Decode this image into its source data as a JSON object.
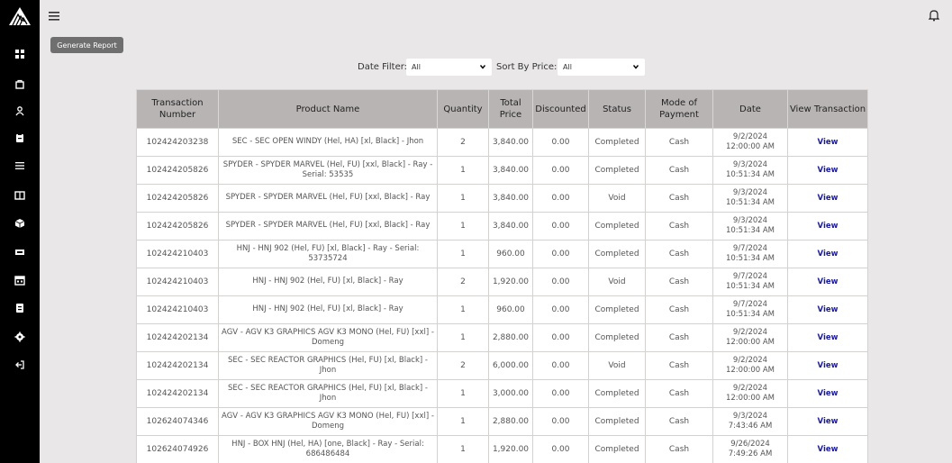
{
  "sidebar": {
    "icons": [
      "dashboard-icon",
      "bag-icon",
      "user-icon",
      "clipboard-icon",
      "list-icon",
      "book-icon",
      "cube-icon",
      "ticket-icon",
      "calendar-icon",
      "document-icon",
      "gear-icon",
      "logout-icon"
    ]
  },
  "toolbar": {
    "generate_label": "Generate Report"
  },
  "filters": {
    "date_label": "Date Filter:",
    "date_value": "All",
    "price_label": "Sort By Price:",
    "price_value": "All"
  },
  "table": {
    "headers": [
      "Transaction Number",
      "Product Name",
      "Quantity",
      "Total Price",
      "Discounted",
      "Status",
      "Mode of Payment",
      "Date",
      "View Transaction"
    ],
    "rows": [
      {
        "txn": "102424203238",
        "product": "SEC - SEC OPEN WINDY (Hel, HA) [xl, Black] - Jhon",
        "qty": "2",
        "total": "3,840.00",
        "discount": "0.00",
        "status": "Completed",
        "payment": "Cash",
        "date": "9/2/2024",
        "time": "12:00:00 AM",
        "view": "View"
      },
      {
        "txn": "102424205826",
        "product": "SPYDER - SPYDER MARVEL (Hel, FU) [xxl, Black] - Ray - Serial: 53535",
        "qty": "1",
        "total": "3,840.00",
        "discount": "0.00",
        "status": "Completed",
        "payment": "Cash",
        "date": "9/3/2024",
        "time": "10:51:34 AM",
        "view": "View"
      },
      {
        "txn": "102424205826",
        "product": "SPYDER - SPYDER MARVEL (Hel, FU) [xxl, Black] - Ray",
        "qty": "1",
        "total": "3,840.00",
        "discount": "0.00",
        "status": "Void",
        "payment": "Cash",
        "date": "9/3/2024",
        "time": "10:51:34 AM",
        "view": "View"
      },
      {
        "txn": "102424205826",
        "product": "SPYDER - SPYDER MARVEL (Hel, FU) [xxl, Black] - Ray",
        "qty": "1",
        "total": "3,840.00",
        "discount": "0.00",
        "status": "Completed",
        "payment": "Cash",
        "date": "9/3/2024",
        "time": "10:51:34 AM",
        "view": "View"
      },
      {
        "txn": "102424210403",
        "product": "HNJ - HNJ 902 (Hel, FU) [xl, Black] - Ray - Serial: 53735724",
        "qty": "1",
        "total": "960.00",
        "discount": "0.00",
        "status": "Completed",
        "payment": "Cash",
        "date": "9/7/2024",
        "time": "10:51:34 AM",
        "view": "View"
      },
      {
        "txn": "102424210403",
        "product": "HNJ - HNJ 902 (Hel, FU) [xl, Black] - Ray",
        "qty": "2",
        "total": "1,920.00",
        "discount": "0.00",
        "status": "Void",
        "payment": "Cash",
        "date": "9/7/2024",
        "time": "10:51:34 AM",
        "view": "View"
      },
      {
        "txn": "102424210403",
        "product": "HNJ - HNJ 902 (Hel, FU) [xl, Black] - Ray",
        "qty": "1",
        "total": "960.00",
        "discount": "0.00",
        "status": "Completed",
        "payment": "Cash",
        "date": "9/7/2024",
        "time": "10:51:34 AM",
        "view": "View"
      },
      {
        "txn": "102424202134",
        "product": "AGV - AGV K3 GRAPHICS AGV K3 MONO (Hel, FU) [xxl] - Domeng",
        "qty": "1",
        "total": "2,880.00",
        "discount": "0.00",
        "status": "Completed",
        "payment": "Cash",
        "date": "9/2/2024",
        "time": "12:00:00 AM",
        "view": "View"
      },
      {
        "txn": "102424202134",
        "product": "SEC - SEC REACTOR GRAPHICS (Hel, FU) [xl, Black] - Jhon",
        "qty": "2",
        "total": "6,000.00",
        "discount": "0.00",
        "status": "Void",
        "payment": "Cash",
        "date": "9/2/2024",
        "time": "12:00:00 AM",
        "view": "View"
      },
      {
        "txn": "102424202134",
        "product": "SEC - SEC REACTOR GRAPHICS (Hel, FU) [xl, Black] - Jhon",
        "qty": "1",
        "total": "3,000.00",
        "discount": "0.00",
        "status": "Completed",
        "payment": "Cash",
        "date": "9/2/2024",
        "time": "12:00:00 AM",
        "view": "View"
      },
      {
        "txn": "102624074346",
        "product": "AGV - AGV K3 GRAPHICS AGV K3 MONO (Hel, FU) [xxl] - Domeng",
        "qty": "1",
        "total": "2,880.00",
        "discount": "0.00",
        "status": "Completed",
        "payment": "Cash",
        "date": "9/3/2024",
        "time": "7:43:46 AM",
        "view": "View"
      },
      {
        "txn": "102624074926",
        "product": "HNJ - BOX HNJ (Hel, HA) [one, Black] - Ray - Serial: 686486484",
        "qty": "1",
        "total": "1,920.00",
        "discount": "0.00",
        "status": "Completed",
        "payment": "Cash",
        "date": "9/26/2024",
        "time": "7:49:26 AM",
        "view": "View"
      }
    ]
  }
}
